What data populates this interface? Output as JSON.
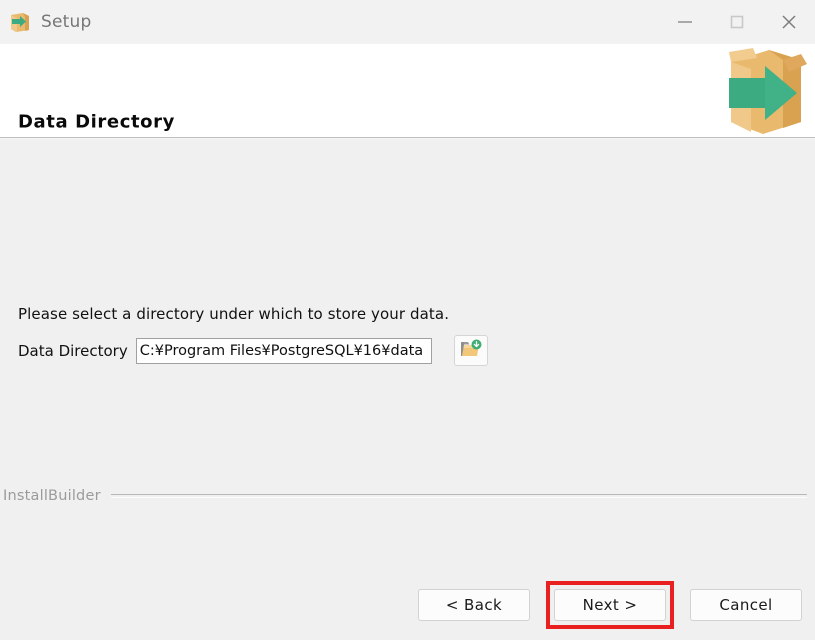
{
  "window": {
    "title": "Setup",
    "icon": "setup-package-icon",
    "controls": {
      "minimize": "minimize-icon",
      "maximize": "maximize-icon",
      "close": "close-icon"
    }
  },
  "header": {
    "title": "Data Directory",
    "art_icon": "package-box-arrow-icon"
  },
  "main": {
    "instruction": "Please select a directory under which to store your data.",
    "field": {
      "label": "Data Directory",
      "value": "C:¥Program Files¥PostgreSQL¥16¥data",
      "placeholder": "",
      "browse_icon": "open-folder-icon"
    }
  },
  "footer": {
    "brand": "InstallBuilder",
    "buttons": [
      {
        "label": "< Back",
        "name": "back-button",
        "highlighted": false
      },
      {
        "label": "Next >",
        "name": "next-button",
        "highlighted": true
      },
      {
        "label": "Cancel",
        "name": "cancel-button",
        "highlighted": false
      }
    ]
  },
  "colors": {
    "titlebar_bg": "#f2f2f2",
    "header_bg": "#ffffff",
    "body_bg": "#f0f0f0",
    "highlight": "#e8201f",
    "box_tan": "#e9b96e",
    "box_tan_dark": "#d9a250",
    "arrow_green": "#3cab82"
  }
}
